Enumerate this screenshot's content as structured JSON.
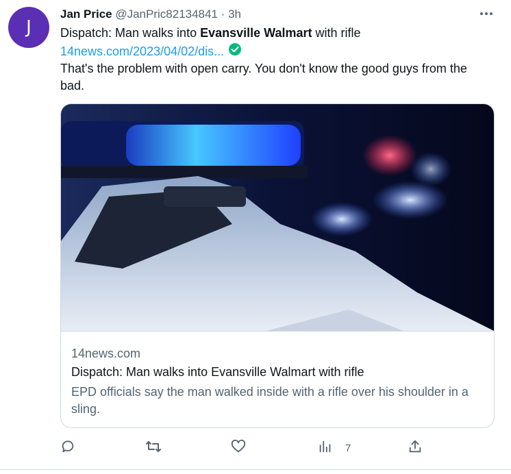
{
  "tweet": {
    "avatar_letter": "J",
    "author_name": "Jan Price",
    "author_handle": "@JanPric82134841",
    "separator": "·",
    "time": "3h",
    "text_prefix": "Dispatch: Man walks into ",
    "text_bold": "Evansville Walmart",
    "text_suffix": " with rifle",
    "link": "14news.com/2023/04/02/dis...",
    "comment": "That's the problem with open carry. You don't know the good guys from the bad."
  },
  "card": {
    "domain": "14news.com",
    "title": "Dispatch: Man walks into Evansville Walmart with rifle",
    "description": "EPD officials say the man walked inside with a rifle over his shoulder in a sling."
  },
  "actions": {
    "views_count": "7"
  },
  "icons": {
    "more": "more-icon",
    "verified": "verified-check-icon",
    "reply": "reply-icon",
    "retweet": "retweet-icon",
    "like": "heart-icon",
    "views": "views-icon",
    "share": "share-icon"
  },
  "colors": {
    "avatar": "#5b2fb3",
    "link": "#1d9bf0",
    "muted": "#536471",
    "verified": "#00ba7c"
  }
}
